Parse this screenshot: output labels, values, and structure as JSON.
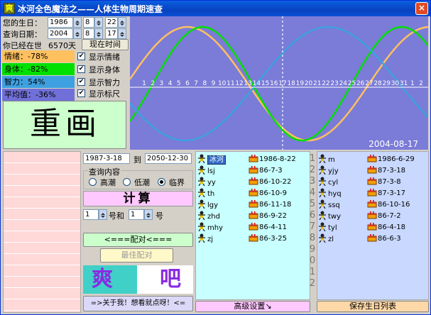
{
  "window": {
    "title": "冰河全色魔法之——人体生物周期速查",
    "icon_glyph": "爽",
    "close_symbol": "×"
  },
  "birth": {
    "label": "您的生日：",
    "year": "1986",
    "month": "8",
    "day": "22"
  },
  "query": {
    "label": "查询日期：",
    "year": "2004",
    "month": "8",
    "day": "17"
  },
  "alive": {
    "label": "你已经在世",
    "value": "6570天"
  },
  "now_button": "现在时间",
  "biorhythm": [
    {
      "label": "情绪：-78%",
      "value": -0.78,
      "color": "#ffc060",
      "check_label": "显示情绪",
      "checked": true
    },
    {
      "label": "身体：-82%",
      "value": -0.82,
      "color": "#00e000",
      "check_label": "显示身体",
      "checked": true
    },
    {
      "label": "智力：54%",
      "value": 0.54,
      "color": "#3ea0e0",
      "check_label": "显示智力",
      "checked": true
    },
    {
      "label": "平均值：-36%",
      "value": -0.36,
      "color": "#7070d8",
      "check_label": "显示标尺",
      "checked": true
    }
  ],
  "redraw_label": "重画",
  "chart_data": {
    "type": "line",
    "x_ticks": [
      "1",
      "2",
      "3",
      "4",
      "5",
      "6",
      "7",
      "8",
      "9",
      "10",
      "11",
      "12",
      "13",
      "14",
      "15",
      "16",
      "17",
      "18",
      "19",
      "20",
      "21",
      "22",
      "23",
      "24",
      "25",
      "26",
      "27",
      "28",
      "29",
      "30",
      "31",
      "1",
      "2"
    ],
    "marker_date": "2004-08-17",
    "marker_tick": "17",
    "series": [
      {
        "period_days": 28,
        "color": "#ffc060"
      },
      {
        "period_days": 23,
        "color": "#00e000"
      },
      {
        "period_days": 33,
        "color": "#3ea0e0"
      }
    ],
    "background": "#7b7bd8"
  },
  "range": {
    "from": "1987-3-18",
    "to_label": "到",
    "to": "2050-12-30"
  },
  "query_content": {
    "label": "查询内容",
    "options": [
      "高潮",
      "低潮",
      "临界"
    ],
    "selected": "临界"
  },
  "calc_button": "计算",
  "pair": {
    "n1": "1",
    "and_label": "号和",
    "n2": "1",
    "suffix": "号"
  },
  "match_button": "<===配对<===",
  "best_button": "最佳配对",
  "cool_chars": [
    "爽",
    "吧"
  ],
  "about_button": "=>关于我！想看就点呀！<=",
  "advanced_button": "高级设置↘",
  "save_button": "保存生日列表",
  "people_left": [
    {
      "name": "冰河",
      "date": "1986-8-22"
    },
    {
      "name": "lsj",
      "date": "86-7-3"
    },
    {
      "name": "yy",
      "date": "86-10-22"
    },
    {
      "name": "th",
      "date": "86-10-9"
    },
    {
      "name": "lgy",
      "date": "86-11-18"
    },
    {
      "name": "zhd",
      "date": "86-9-22"
    },
    {
      "name": "mhy",
      "date": "86-4-11"
    },
    {
      "name": "zj",
      "date": "86-3-25"
    }
  ],
  "people_right": [
    {
      "name": "m",
      "date": "1986-6-29"
    },
    {
      "name": "yjy",
      "date": "87-3-18"
    },
    {
      "name": "cyl",
      "date": "87-3-8"
    },
    {
      "name": "hyq",
      "date": "87-3-17"
    },
    {
      "name": "ssq",
      "date": "86-10-16"
    },
    {
      "name": "twy",
      "date": "86-7-2"
    },
    {
      "name": "tyl",
      "date": "86-4-18"
    },
    {
      "name": "zl",
      "date": "86-6-3"
    }
  ],
  "row_numbers": [
    "1",
    "2",
    "3",
    "4",
    "5",
    "6",
    "7",
    "8",
    "9",
    "0",
    "1",
    "2"
  ]
}
